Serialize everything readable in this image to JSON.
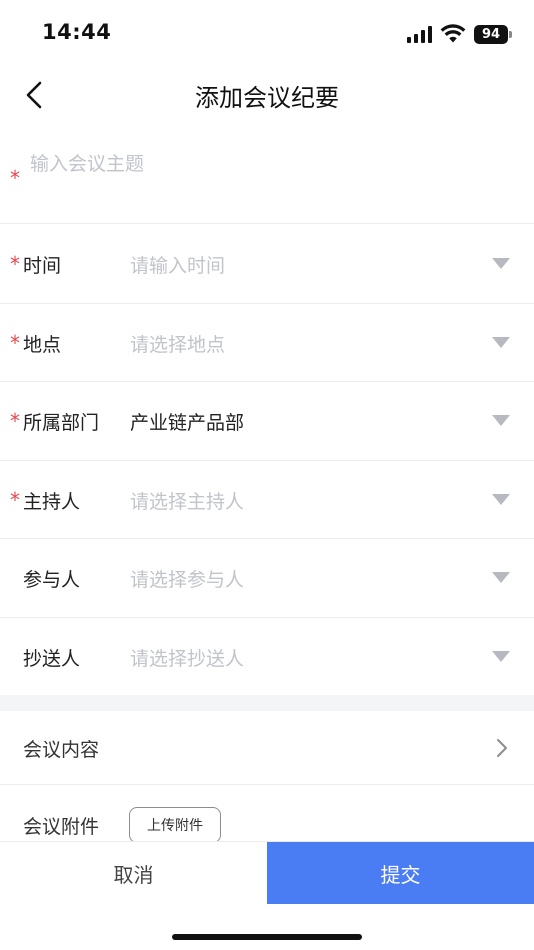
{
  "status_bar": {
    "time": "14:44",
    "battery": "94"
  },
  "nav": {
    "title": "添加会议纪要"
  },
  "topic": {
    "placeholder": "输入会议主题",
    "required_mark": "*"
  },
  "form": {
    "rows": [
      {
        "label": "时间",
        "required": "*",
        "value": "",
        "placeholder": "请输入时间"
      },
      {
        "label": "地点",
        "required": "*",
        "value": "",
        "placeholder": "请选择地点"
      },
      {
        "label": "所属部门",
        "required": "*",
        "value": "产业链产品部",
        "placeholder": ""
      },
      {
        "label": "主持人",
        "required": "*",
        "value": "",
        "placeholder": "请选择主持人"
      },
      {
        "label": "参与人",
        "required": "",
        "value": "",
        "placeholder": "请选择参与人"
      },
      {
        "label": "抄送人",
        "required": "",
        "value": "",
        "placeholder": "请选择抄送人"
      }
    ]
  },
  "content": {
    "label": "会议内容"
  },
  "attachment": {
    "label": "会议附件",
    "upload_label": "上传附件"
  },
  "actions": {
    "cancel_label": "取消",
    "submit_label": "提交"
  },
  "colors": {
    "accent": "#4a7cf3",
    "required": "#e5484d",
    "placeholder": "#c2c4cc"
  }
}
